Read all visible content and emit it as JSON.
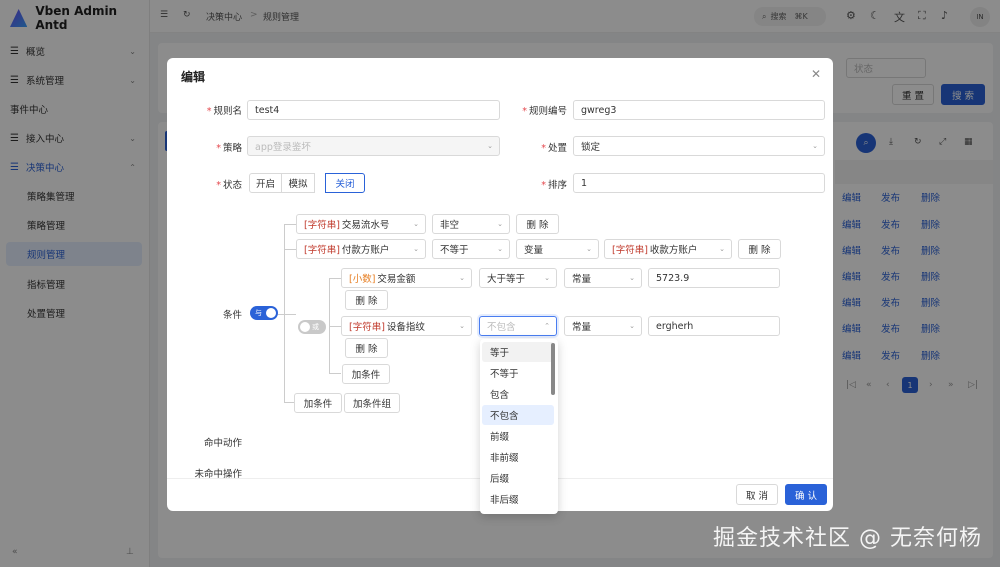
{
  "app": {
    "name": "Vben Admin Antd"
  },
  "header": {
    "breadcrumb_parent": "决策中心",
    "breadcrumb_sep": ">",
    "breadcrumb_current": "规则管理",
    "search_label": "搜索",
    "search_shortcut": "⌘K",
    "avatar_initials": "IN"
  },
  "sidebar": {
    "items": [
      {
        "label": "概览"
      },
      {
        "label": "系统管理"
      },
      {
        "label": "事件中心"
      },
      {
        "label": "接入中心"
      },
      {
        "label": "决策中心"
      }
    ],
    "sub_items": [
      {
        "label": "策略集管理"
      },
      {
        "label": "策略管理"
      },
      {
        "label": "规则管理"
      },
      {
        "label": "指标管理"
      },
      {
        "label": "处置管理"
      }
    ]
  },
  "background": {
    "status_placeholder": "状态",
    "reset_label": "重 置",
    "search_label": "搜 索",
    "row_actions": {
      "edit": "编辑",
      "publish": "发布",
      "delete": "删除"
    },
    "page_current": "1"
  },
  "modal": {
    "title": "编辑",
    "fields": {
      "rule_name_label": "规则名",
      "rule_name_value": "test4",
      "rule_code_label": "规则编号",
      "rule_code_value": "gwreg3",
      "strategy_label": "策略",
      "strategy_value": "app登录鉴坏",
      "disposal_label": "处置",
      "disposal_value": "锁定",
      "status_label": "状态",
      "status_options": [
        "开启",
        "模拟",
        "关闭"
      ],
      "order_label": "排序",
      "order_value": "1",
      "condition_label": "条件",
      "hit_action_label": "命中动作",
      "miss_action_label": "未命中操作"
    },
    "conditions": {
      "toggle_and": "与",
      "toggle_or": "或",
      "row1": {
        "tag": "[字符串]",
        "field": "交易流水号",
        "op": "非空",
        "delete": "删 除"
      },
      "row2": {
        "tag": "[字符串]",
        "field": "付款方账户",
        "op": "不等于",
        "value_type": "变量",
        "tag2": "[字符串]",
        "field2": "收款方账户",
        "delete": "删 除"
      },
      "row3": {
        "tag": "[小数]",
        "field": "交易金额",
        "op": "大于等于",
        "value_type": "常量",
        "value": "5723.9",
        "delete": "删 除"
      },
      "row4": {
        "tag": "[字符串]",
        "field": "设备指纹",
        "op_placeholder": "不包含",
        "value_type": "常量",
        "value": "ergherh",
        "delete": "删 除"
      },
      "add_condition_inner": "加条件",
      "add_condition": "加条件",
      "add_condition_group": "加条件组"
    },
    "footer": {
      "cancel": "取 消",
      "confirm": "确 认"
    }
  },
  "dropdown": {
    "options": [
      "等于",
      "不等于",
      "包含",
      "不包含",
      "前缀",
      "非前缀",
      "后缀",
      "非后缀"
    ]
  },
  "watermark": "掘金技术社区 @ 无奈何杨"
}
